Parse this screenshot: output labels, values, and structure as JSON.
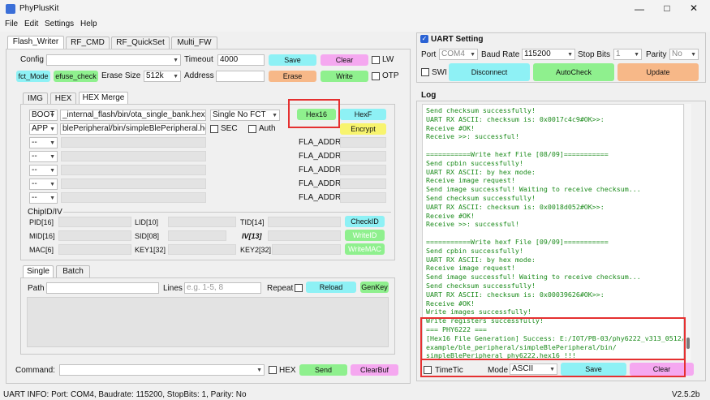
{
  "window": {
    "title": "PhyPlusKit"
  },
  "menu": [
    "File",
    "Edit",
    "Settings",
    "Help"
  ],
  "main_tabs": [
    "Flash_Writer",
    "RF_CMD",
    "RF_QuickSet",
    "Multi_FW"
  ],
  "config": {
    "label": "Config",
    "value": "",
    "timeout_label": "Timeout",
    "timeout_value": "4000",
    "save": "Save",
    "clear": "Clear",
    "lw": "LW",
    "fct_mode": "fct_Mode",
    "efuse_check": "efuse_check",
    "erase_size_label": "Erase Size",
    "erase_size": "512k",
    "address_label": "Address",
    "address_value": "",
    "erase": "Erase",
    "write": "Write",
    "otp": "OTP"
  },
  "sub_tabs": [
    "IMG",
    "HEX",
    "HEX Merge"
  ],
  "hex_rows": [
    {
      "type": "BOOT",
      "path": "_internal_flash/bin/ota_single_bank.hex",
      "mode": "Single No FCT"
    },
    {
      "type": "APP",
      "path": "blePeripheral/bin/simpleBlePeripheral.hex",
      "sec": "SEC",
      "auth": "Auth"
    }
  ],
  "hex_buttons": {
    "hex16": "Hex16",
    "hexf": "HexF",
    "encrypt": "Encrypt"
  },
  "fla_rows": [
    {
      "combo": "--",
      "label": "FLA_ADDR"
    },
    {
      "combo": "--",
      "label": "FLA_ADDR"
    },
    {
      "combo": "--",
      "label": "FLA_ADDR"
    },
    {
      "combo": "--",
      "label": "FLA_ADDR"
    },
    {
      "combo": "--",
      "label": "FLA_ADDR"
    }
  ],
  "chipid": {
    "title": "ChipID/IV",
    "pid": "PID[16]",
    "lid": "LID[10]",
    "tid": "TID[14]",
    "checkid": "CheckID",
    "mid": "MID[16]",
    "sid": "SID[08]",
    "iv": "IV[13]",
    "writeid": "WriteID",
    "mac": "MAC[6]",
    "key1": "KEY1[32]",
    "key2": "KEY2[32]",
    "writemac": "WriteMAC"
  },
  "batch_tabs": [
    "Single",
    "Batch"
  ],
  "batch": {
    "path_label": "Path",
    "lines_label": "Lines",
    "lines_placeholder": "e.g. 1-5, 8",
    "repeat": "Repeat",
    "reload": "Reload",
    "genkey": "GenKey"
  },
  "command": {
    "label": "Command:",
    "hex": "HEX",
    "send": "Send",
    "clearbuf": "ClearBuf"
  },
  "uart": {
    "title": "UART Setting",
    "port_label": "Port",
    "port": "COM4",
    "baud_label": "Baud Rate",
    "baud": "115200",
    "stop_label": "Stop Bits",
    "stop": "1",
    "parity_label": "Parity",
    "parity": "No",
    "sw": "SWI",
    "disconnect": "Disconnect",
    "autocheck": "AutoCheck",
    "update": "Update"
  },
  "log": {
    "title": "Log",
    "lines": [
      "Send checksum successfully!",
      "UART RX ASCII: checksum is: 0x0017c4c9#OK>>:",
      "Receive #OK!",
      "Receive >>: successful!",
      "",
      "===========Write hexf File [08/09]===========",
      "Send cpbin successfully!",
      "UART RX ASCII: by hex mode:",
      "Receive image request!",
      "Send image successful! Waiting to receive checksum...",
      "Send checksum successfully!",
      "UART RX ASCII: checksum is: 0x0018d052#OK>>:",
      "Receive #OK!",
      "Receive >>: successful!",
      "",
      "===========Write hexf File [09/09]===========",
      "Send cpbin successfully!",
      "UART RX ASCII: by hex mode:",
      "Receive image request!",
      "Send image successful! Waiting to receive checksum...",
      "Send checksum successfully!",
      "UART RX ASCII: checksum is: 0x00039626#OK>>:",
      "Receive #OK!",
      "Write images successfully!",
      "Write registers successfully!",
      "=== PHY6222 ===",
      "[Hex16 File Generation] Success: E:/IOT/PB-03/phy6222_v313_0512/",
      "example/ble_peripheral/simpleBlePeripheral/bin/",
      "simpleBlePeripheral_phy6222.hex16 !!!"
    ]
  },
  "log_bottom": {
    "timetic": "TimeTic",
    "mode_label": "Mode",
    "mode": "ASCII",
    "save": "Save",
    "clear": "Clear"
  },
  "status": {
    "text": "UART INFO: Port: COM4, Baudrate: 115200, StopBits: 1, Parity: No",
    "version": "V2.5.2b"
  },
  "colors": {
    "highlight": "#e53030",
    "cyan": "#8ef1f5",
    "pink": "#f5a8f0",
    "green": "#8ff08e",
    "orange": "#f7b888",
    "yellow": "#f8f46e"
  }
}
